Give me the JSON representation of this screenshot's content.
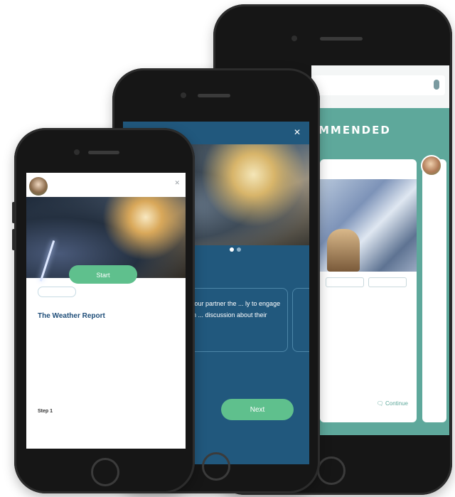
{
  "colors": {
    "teal": "#5ea89b",
    "navy_screen": "#21587d",
    "green_button": "#5fc08d",
    "title_blue": "#1f4e79"
  },
  "phone_back": {
    "banner_title": "MMENDED",
    "banner_subtitle": "",
    "card_header": "",
    "card_title": "",
    "card_text": "",
    "continue_label": "Continue",
    "continue_icon": "chat-bubble-icon",
    "search_icon": "mic-icon"
  },
  "phone_middle": {
    "close_icon": "close-icon",
    "prompt_text": "your partner the ... ly to engage in ... discussion about their",
    "next_label": "Next",
    "carousel_dots": 2,
    "carousel_active": 0
  },
  "phone_front": {
    "user_name": "",
    "close_icon": "close-icon",
    "start_label": "Start",
    "section_label": "",
    "title": "The Weather Report",
    "body_text": "",
    "step_label": "Step 1",
    "step_text": ""
  }
}
